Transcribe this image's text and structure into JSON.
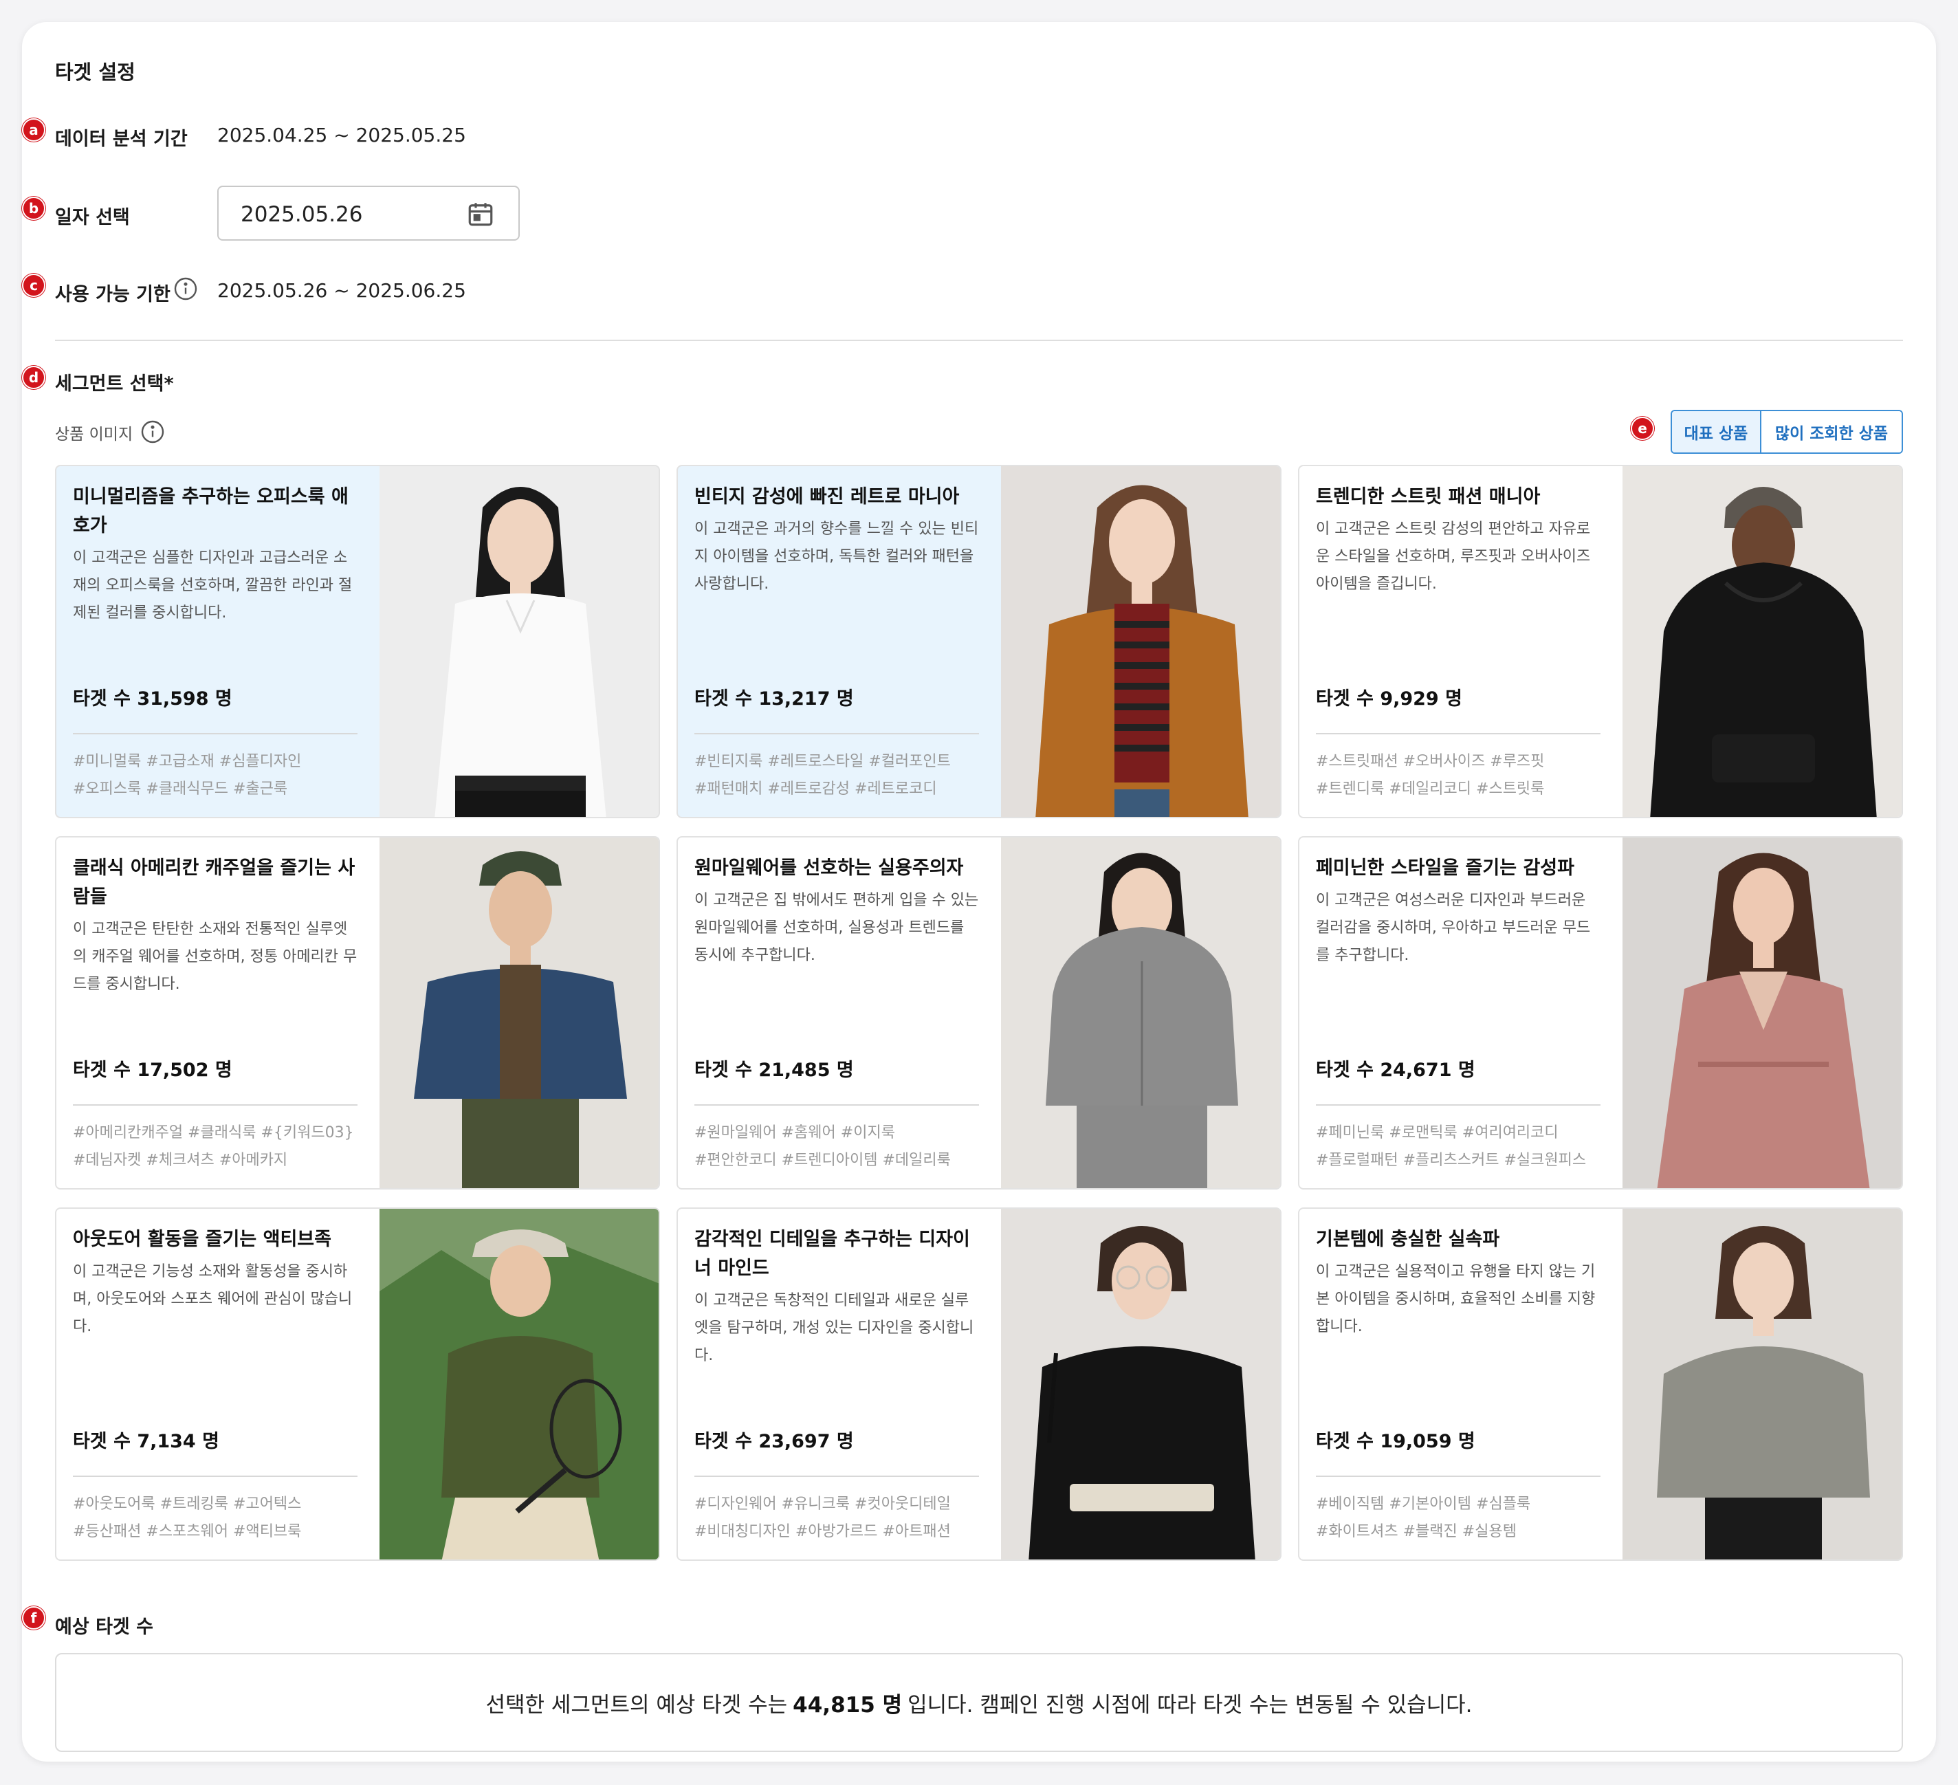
{
  "panel": {
    "title": "타겟 설정"
  },
  "markers": [
    "a",
    "b",
    "c",
    "d",
    "e",
    "f"
  ],
  "analysis_period": {
    "label": "데이터 분석 기간",
    "value": "2025.04.25 ~ 2025.05.25"
  },
  "date_select": {
    "label": "일자 선택",
    "value": "2025.05.26"
  },
  "usable_period": {
    "label": "사용 가능 기한",
    "value": "2025.05.26 ~ 2025.06.25"
  },
  "segment": {
    "label": "세그먼트 선택*",
    "image_label": "상품 이미지",
    "toggle": {
      "option1": "대표 상품",
      "option2": "많이 조회한 상품",
      "selected": "대표 상품"
    }
  },
  "cards": [
    {
      "title": "미니멀리즘을 추구하는 오피스룩 애호가",
      "desc": "이 고객군은 심플한 디자인과 고급스러운 소재의 오피스룩을 선호하며, 깔끔한 라인과 절제된 컬러를 중시합니다.",
      "count": "타겟 수 31,598 명",
      "tags1": "#미니멀룩 #고급소재 #심플디자인",
      "tags2": "#오피스룩 #클래식무드 #출근룩",
      "selected": true,
      "image": "woman-white-shirt"
    },
    {
      "title": "빈티지 감성에 빠진 레트로 마니아",
      "desc": "이 고객군은 과거의 향수를 느낄 수 있는 빈티지 아이템을 선호하며, 독특한 컬러와 패턴을 사랑합니다.",
      "count": "타겟 수 13,217 명",
      "tags1": "#빈티지룩 #레트로스타일 #컬러포인트",
      "tags2": "#패턴매치 #레트로감성 #레트로코디",
      "selected": true,
      "image": "woman-corduroy-jacket"
    },
    {
      "title": "트렌디한 스트릿 패션 매니아",
      "desc": "이 고객군은 스트릿 감성의 편안하고 자유로운 스타일을 선호하며, 루즈핏과 오버사이즈 아이템을 즐깁니다.",
      "count": "타겟 수 9,929 명",
      "tags1": "#스트릿패션 #오버사이즈 #루즈핏",
      "tags2": "#트렌디룩 #데일리코디 #스트릿룩",
      "selected": false,
      "image": "man-black-hoodie"
    },
    {
      "title": "클래식 아메리칸 캐주얼을 즐기는 사람들",
      "desc": "이 고객군은 탄탄한 소재와 전통적인 실루엣의 캐주얼 웨어를 선호하며, 정통 아메리칸 무드를 중시합니다.",
      "count": "타겟 수 17,502 명",
      "tags1": "#아메리칸캐주얼 #클래식룩 #{키워드03}",
      "tags2": "#데님자켓 #체크셔츠 #아메카지",
      "selected": false,
      "image": "man-denim-jacket"
    },
    {
      "title": "원마일웨어를 선호하는 실용주의자",
      "desc": "이 고객군은 집 밖에서도 편하게 입을 수 있는 원마일웨어를 선호하며, 실용성과 트렌드를 동시에 추구합니다.",
      "count": "타겟 수 21,485 명",
      "tags1": "#원마일웨어 #홈웨어 #이지룩",
      "tags2": "#편안한코디 #트렌디아이템 #데일리룩",
      "selected": false,
      "image": "woman-grey-zip-hoodie"
    },
    {
      "title": "페미닌한 스타일을 즐기는 감성파",
      "desc": "이 고객군은 여성스러운 디자인과 부드러운 컬러감을 중시하며, 우아하고 부드러운 무드를 추구합니다.",
      "count": "타겟 수 24,671 명",
      "tags1": "#페미닌룩 #로맨틱룩 #여리여리코디",
      "tags2": "#플로럴패턴 #플리츠스커트 #실크원피스",
      "selected": false,
      "image": "woman-pink-wrap-dress"
    },
    {
      "title": "아웃도어 활동을 즐기는 액티브족",
      "desc": "이 고객군은 기능성 소재와 활동성을 중시하며, 아웃도어와 스포츠 웨어에 관심이 많습니다.",
      "count": "타겟 수 7,134 명",
      "tags1": "#아웃도어룩 #트레킹룩 #고어텍스",
      "tags2": "#등산패션 #스포츠웨어 #액티브룩",
      "selected": false,
      "image": "woman-tennis-outdoor"
    },
    {
      "title": "감각적인 디테일을 추구하는 디자이너 마인드",
      "desc": "이 고객군은 독창적인 디테일과 새로운 실루엣을 탐구하며, 개성 있는 디자인을 중시합니다.",
      "count": "타겟 수 23,697 명",
      "tags1": "#디자인웨어 #유니크룩 #컷아웃디테일",
      "tags2": "#비대칭디자인 #아방가르드 #아트패션",
      "selected": false,
      "image": "woman-black-blazer-glasses"
    },
    {
      "title": "기본템에 충실한 실속파",
      "desc": "이 고객군은 실용적이고 유행을 타지 않는 기본 아이템을 중시하며, 효율적인 소비를 지향합니다.",
      "count": "타겟 수 19,059 명",
      "tags1": "#베이직템 #기본아이템 #심플룩",
      "tags2": "#화이트셔츠 #블랙진 #실용템",
      "selected": false,
      "image": "woman-grey-sweatshirt"
    }
  ],
  "estimate": {
    "label": "예상 타겟 수",
    "prefix": "선택한 세그먼트의 예상 타겟 수는",
    "value": "44,815 명",
    "suffix": "입니다. 캠페인 진행 시점에 따라 타겟 수는 변동될 수 있습니다."
  },
  "colors": {
    "accent": "#1f6fbf",
    "marker": "#d2141c",
    "selected_card": "#e8f4fd"
  }
}
